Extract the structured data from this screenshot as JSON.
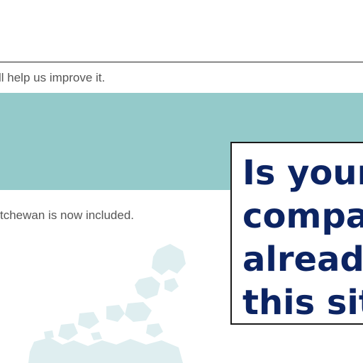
{
  "feedback": {
    "text": "ll help us improve it."
  },
  "notice": {
    "text": "tchewan is now included."
  },
  "map": {
    "icon": "canada-map-icon",
    "color": "#dfeef0"
  },
  "callout": {
    "lines": [
      "Is your",
      "compa",
      "already",
      "this site"
    ],
    "text_color": "#0c2463"
  },
  "colors": {
    "hero_band": "#94caca"
  }
}
